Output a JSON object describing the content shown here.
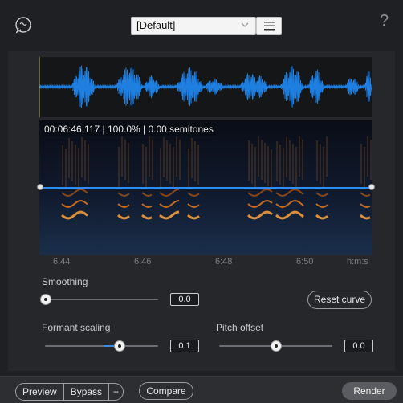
{
  "topbar": {
    "preset_value": "[Default]",
    "help_label": "?"
  },
  "readout": "00:06:46.117 | 100.0% | 0.00 semitones",
  "time_axis": {
    "ticks": [
      "6:44",
      "6:46",
      "6:48",
      "6:50"
    ],
    "unit": "h:m:s"
  },
  "controls": {
    "smoothing": {
      "label": "Smoothing",
      "value": "0.0",
      "fraction": 0.0
    },
    "reset_label": "Reset curve",
    "formant": {
      "label": "Formant scaling",
      "value": "0.1",
      "fraction": 0.66
    },
    "pitch": {
      "label": "Pitch offset",
      "value": "0.0",
      "fraction": 0.5
    }
  },
  "bottombar": {
    "preview_label": "Preview",
    "bypass_label": "Bypass",
    "plus_label": "+",
    "compare_label": "Compare",
    "render_label": "Render"
  },
  "colors": {
    "accent": "#3a8ae0",
    "waveform": "#1e7fe0",
    "curve": "#2f8cf0"
  }
}
